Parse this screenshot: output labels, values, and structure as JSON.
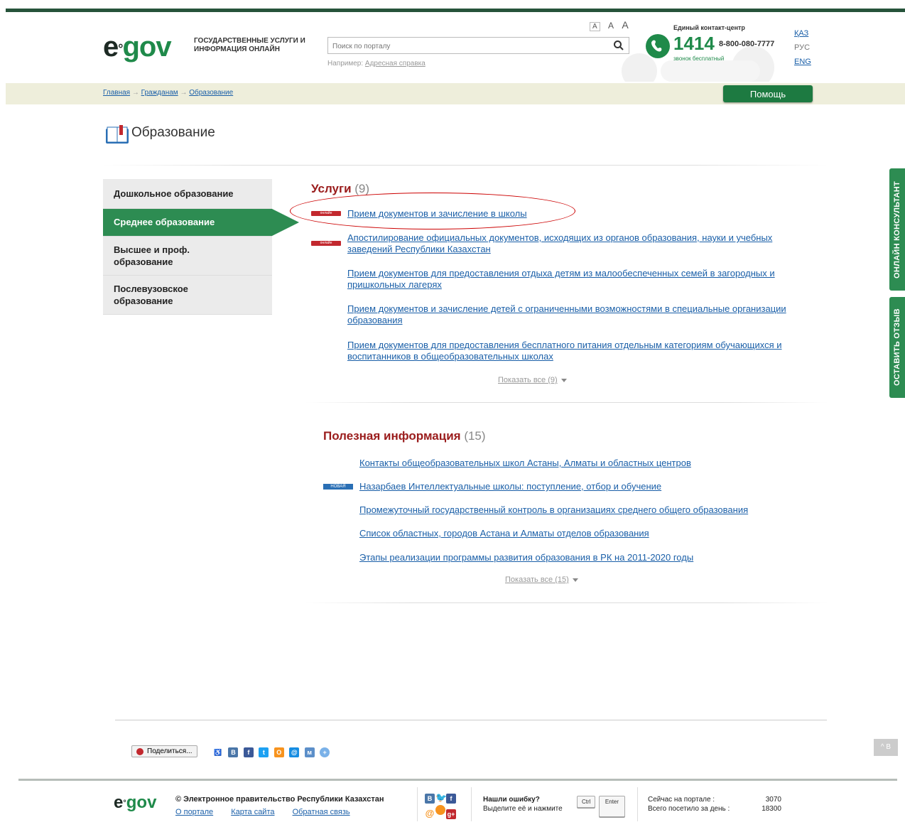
{
  "header": {
    "logo_e": "e",
    "logo_gov": "gov",
    "tagline": "ГОСУДАРСТВЕННЫЕ УСЛУГИ И ИНФОРМАЦИЯ ОНЛАЙН",
    "search_placeholder": "Поиск по порталу",
    "example_label": "Например:",
    "example_link": "Адресная справка",
    "font_sizes": [
      "A",
      "A",
      "A"
    ],
    "contact_title": "Единый контакт-центр",
    "phone": "1414",
    "phone_alt": "8-800-080-7777",
    "phone_free": "звонок бесплатный",
    "languages": [
      "ҚАЗ",
      "РУС",
      "ENG"
    ],
    "active_language": "РУС"
  },
  "breadcrumbs": [
    "Главная",
    "Гражданам",
    "Образование"
  ],
  "help_button": "Помощь",
  "page_title": "Образование",
  "sidebar": {
    "items": [
      {
        "label": "Дошкольное образование",
        "active": false
      },
      {
        "label": "Среднее образование",
        "active": true
      },
      {
        "label": "Высшее и проф. образование",
        "active": false
      },
      {
        "label": "Послевузовское образование",
        "active": false
      }
    ]
  },
  "services": {
    "title": "Услуги",
    "count": "(9)",
    "badge_text": "онлайн",
    "items": [
      {
        "label": "Прием документов и зачисление в школы",
        "online": true
      },
      {
        "label": "Апостилирование официальных документов, исходящих из органов образования, науки и учебных заведений Республики Казахстан",
        "online": true
      },
      {
        "label": "Прием документов для предоставления отдыха детям из малообеспеченных семей в загородных и пришкольных лагерях",
        "online": false
      },
      {
        "label": "Прием документов и зачисление детей с ограниченными возможностями в специальные организации образования",
        "online": false
      },
      {
        "label": "Прием документов для предоставления бесплатного питания отдельным категориям обучающихся и воспитанников в общеобразовательных школах",
        "online": false
      }
    ],
    "show_all": "Показать все (9)"
  },
  "useful_info": {
    "title": "Полезная информация",
    "count": "(15)",
    "badge_new": "НОВАЯ",
    "items": [
      {
        "label": "Контакты общеобразовательных школ Астаны, Алматы и областных центров",
        "new": false
      },
      {
        "label": "Назарбаев Интеллектуальные школы: поступление, отбор и обучение",
        "new": true
      },
      {
        "label": "Промежуточный государственный контроль в организациях среднего общего образования",
        "new": false
      },
      {
        "label": "Список областных, городов Астана и Алматы отделов образования",
        "new": false
      },
      {
        "label": "Этапы реализации программы развития образования в РК на 2011-2020 годы",
        "new": false
      }
    ],
    "show_all": "Показать все (15)"
  },
  "side_tabs": {
    "consultant": "ОНЛАЙН КОНСУЛЬТАНТ",
    "feedback": "ОСТАВИТЬ ОТЗЫВ"
  },
  "share": {
    "button": "Поделиться...",
    "icons": [
      "В",
      "f",
      "t",
      "О",
      "@",
      "м"
    ]
  },
  "to_top": "^ В",
  "footer": {
    "copyright": "© Электронное правительство Республики Казахстан",
    "links": [
      "О портале",
      "Карта сайта",
      "Обратная связь"
    ],
    "error_title": "Нашли ошибку?",
    "error_text": "Выделите её и нажмите",
    "key_ctrl": "Ctrl",
    "key_enter": "Enter",
    "stat_online_label": "Сейчас на портале :",
    "stat_online_value": "3070",
    "stat_day_label": "Всего посетило за день :",
    "stat_day_value": "18300"
  },
  "colors": {
    "brand_green": "#1f8a4a",
    "sidebar_active": "#2d8c52",
    "heading_red": "#9a1c1c",
    "link_blue": "#1a5fa8",
    "breadcrumb_bg": "#eeeedb"
  }
}
